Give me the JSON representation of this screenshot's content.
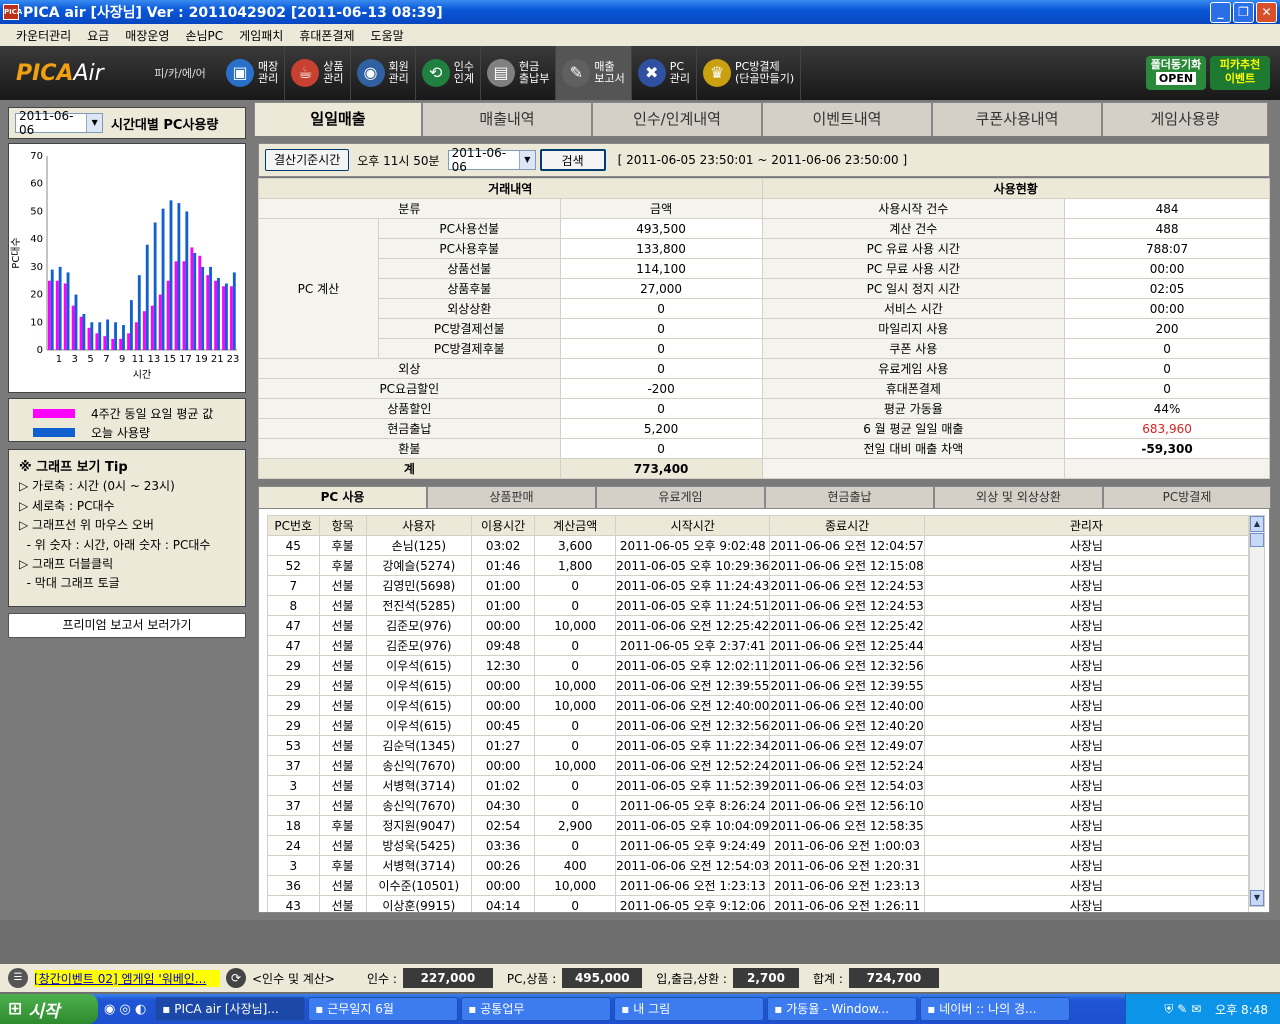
{
  "window": {
    "title": "PICA air [사장님]   Ver : 2011042902 [2011-06-13 08:39]"
  },
  "menu": [
    "카운터관리",
    "요금",
    "매장운영",
    "손님PC",
    "게임패치",
    "휴대폰결제",
    "도움말"
  ],
  "toolbar": {
    "logo_main": "PICA",
    "logo_sub": "Air",
    "region": "피/카/에/어",
    "items": [
      {
        "label1": "매장",
        "label2": "관리",
        "icon": "monitor-icon",
        "color": "#2a70c8",
        "glyph": "▣"
      },
      {
        "label1": "상품",
        "label2": "관리",
        "icon": "cup-icon",
        "color": "#c84030",
        "glyph": "☕"
      },
      {
        "label1": "회원",
        "label2": "관리",
        "icon": "globe-icon",
        "color": "#3060a0",
        "glyph": "◉"
      },
      {
        "label1": "인수",
        "label2": "인계",
        "icon": "handover-icon",
        "color": "#208040",
        "glyph": "⟲"
      },
      {
        "label1": "현금",
        "label2": "출납부",
        "icon": "cash-icon",
        "color": "#808080",
        "glyph": "▤"
      },
      {
        "label1": "매출",
        "label2": "보고서",
        "icon": "report-icon",
        "color": "#606060",
        "glyph": "✎"
      },
      {
        "label1": "PC",
        "label2": "관리",
        "icon": "tools-icon",
        "color": "#3050a0",
        "glyph": "✖"
      },
      {
        "label1": "PC방결제",
        "label2": "(단골만들기)",
        "icon": "crown-icon",
        "color": "#c8a010",
        "glyph": "♛"
      }
    ],
    "promo1_a": "폴더동기화",
    "promo1_b": "OPEN",
    "promo2_a": "피카추천",
    "promo2_b": "이벤트"
  },
  "leftpanel": {
    "date": "2011-06-06",
    "title": "시간대별 PC사용량",
    "legend_avg": "4주간 동일 요일 평균 값",
    "legend_today": "오늘 사용량",
    "tip_title": "※ 그래프 보기 Tip",
    "tips": [
      "▷ 가로축 : 시간 (0시 ~ 23시)",
      "▷ 세로축 : PC대수",
      "▷ 그래프선 위 마우스 오버",
      "  - 위 숫자 : 시간, 아래 숫자 : PC대수",
      "▷ 그래프 더블클릭",
      "  - 막대 그래프 토글"
    ],
    "premium": "프리미엄 보고서 보러가기"
  },
  "chart_data": {
    "type": "bar",
    "xlabel": "시간",
    "ylabel": "PC대수",
    "ylim": [
      0,
      70
    ],
    "yticks": [
      0,
      10,
      20,
      30,
      40,
      50,
      60,
      70
    ],
    "xticks": [
      "1",
      "3",
      "5",
      "7",
      "9",
      "11",
      "13",
      "15",
      "17",
      "19",
      "21",
      "23"
    ],
    "categories": [
      0,
      1,
      2,
      3,
      4,
      5,
      6,
      7,
      8,
      9,
      10,
      11,
      12,
      13,
      14,
      15,
      16,
      17,
      18,
      19,
      20,
      21,
      22,
      23
    ],
    "series": [
      {
        "name": "4주간 동일 요일 평균 값",
        "color": "#ff00ff",
        "values": [
          25,
          25,
          24,
          16,
          12,
          8,
          6,
          5,
          4,
          4,
          6,
          10,
          14,
          16,
          20,
          25,
          32,
          32,
          37,
          34,
          27,
          25,
          23,
          23
        ]
      },
      {
        "name": "오늘 사용량",
        "color": "#1060d0",
        "values": [
          29,
          30,
          28,
          20,
          13,
          10,
          10,
          11,
          10,
          9,
          18,
          27,
          38,
          46,
          51,
          54,
          53,
          50,
          35,
          30,
          30,
          26,
          24,
          28
        ]
      }
    ]
  },
  "tabs": [
    "일일매출",
    "매출내역",
    "인수/인계내역",
    "이벤트내역",
    "쿠폰사용내역",
    "게임사용량"
  ],
  "search": {
    "button1": "결산기준시간",
    "time": "오후 11시 50분",
    "date": "2011-06-06",
    "button2": "검색",
    "range": "[ 2011-06-05 23:50:01 ~ 2011-06-06 23:50:00 ]"
  },
  "summary": {
    "h_left": "거래내역",
    "h_right": "사용현황",
    "col_cat": "분류",
    "col_amt": "금액",
    "group": "PC 계산",
    "rows_left": [
      {
        "label": "PC사용선불",
        "value": "493,500"
      },
      {
        "label": "PC사용후불",
        "value": "133,800"
      },
      {
        "label": "상품선불",
        "value": "114,100"
      },
      {
        "label": "상품후불",
        "value": "27,000"
      },
      {
        "label": "외상상환",
        "value": "0"
      },
      {
        "label": "PC방결제선불",
        "value": "0"
      },
      {
        "label": "PC방결제후불",
        "value": "0"
      }
    ],
    "rows_left2": [
      {
        "label": "외상",
        "value": "0"
      },
      {
        "label": "PC요금할인",
        "value": "-200"
      },
      {
        "label": "상품할인",
        "value": "0"
      },
      {
        "label": "현금출납",
        "value": "5,200"
      },
      {
        "label": "환불",
        "value": "0"
      }
    ],
    "total_label": "계",
    "total_value": "773,400",
    "rows_right": [
      {
        "label": "사용시작 건수",
        "value": "484"
      },
      {
        "label": "계산 건수",
        "value": "488"
      },
      {
        "label": "PC 유료 사용 시간",
        "value": "788:07"
      },
      {
        "label": "PC 무료 사용 시간",
        "value": "00:00"
      },
      {
        "label": "PC 일시 정지 시간",
        "value": "02:05"
      },
      {
        "label": "서비스 시간",
        "value": "00:00"
      },
      {
        "label": "마일리지 사용",
        "value": "200"
      },
      {
        "label": "쿠폰 사용",
        "value": "0"
      },
      {
        "label": "유료게임 사용",
        "value": "0"
      },
      {
        "label": "휴대폰결제",
        "value": "0"
      },
      {
        "label": "평균 가동율",
        "value": "44%"
      },
      {
        "label": "6 월 평균 일일 매출",
        "value": "683,960"
      },
      {
        "label": "전일 대비 매출 차액",
        "value": "-59,300"
      }
    ],
    "colors": {
      "red": "#e02020"
    }
  },
  "subtabs": [
    "PC 사용",
    "상품판매",
    "유료게임",
    "현금출납",
    "외상 및 외상상환",
    "PC방결제"
  ],
  "usage": {
    "columns": [
      "PC번호",
      "항목",
      "사용자",
      "이용시간",
      "계산금액",
      "시작시간",
      "종료시간",
      "관리자"
    ],
    "rows": [
      [
        "45",
        "후불",
        "손님(125)",
        "03:02",
        "3,600",
        "2011-06-05 오후 9:02:48",
        "2011-06-06 오전 12:04:57",
        "사장님"
      ],
      [
        "52",
        "후불",
        "강예슬(5274)",
        "01:46",
        "1,800",
        "2011-06-05 오후 10:29:36",
        "2011-06-06 오전 12:15:08",
        "사장님"
      ],
      [
        "7",
        "선불",
        "김영민(5698)",
        "01:00",
        "0",
        "2011-06-05 오후 11:24:43",
        "2011-06-06 오전 12:24:53",
        "사장님"
      ],
      [
        "8",
        "선불",
        "전진석(5285)",
        "01:00",
        "0",
        "2011-06-05 오후 11:24:51",
        "2011-06-06 오전 12:24:53",
        "사장님"
      ],
      [
        "47",
        "선불",
        "김준모(976)",
        "00:00",
        "10,000",
        "2011-06-06 오전 12:25:42",
        "2011-06-06 오전 12:25:42",
        "사장님"
      ],
      [
        "47",
        "선불",
        "김준모(976)",
        "09:48",
        "0",
        "2011-06-05 오후 2:37:41",
        "2011-06-06 오전 12:25:44",
        "사장님"
      ],
      [
        "29",
        "선불",
        "이우석(615)",
        "12:30",
        "0",
        "2011-06-05 오후 12:02:11",
        "2011-06-06 오전 12:32:56",
        "사장님"
      ],
      [
        "29",
        "선불",
        "이우석(615)",
        "00:00",
        "10,000",
        "2011-06-06 오전 12:39:55",
        "2011-06-06 오전 12:39:55",
        "사장님"
      ],
      [
        "29",
        "선불",
        "이우석(615)",
        "00:00",
        "10,000",
        "2011-06-06 오전 12:40:00",
        "2011-06-06 오전 12:40:00",
        "사장님"
      ],
      [
        "29",
        "선불",
        "이우석(615)",
        "00:45",
        "0",
        "2011-06-06 오전 12:32:56",
        "2011-06-06 오전 12:40:20",
        "사장님"
      ],
      [
        "53",
        "선불",
        "김순덕(1345)",
        "01:27",
        "0",
        "2011-06-05 오후 11:22:34",
        "2011-06-06 오전 12:49:07",
        "사장님"
      ],
      [
        "37",
        "선불",
        "송신익(7670)",
        "00:00",
        "10,000",
        "2011-06-06 오전 12:52:24",
        "2011-06-06 오전 12:52:24",
        "사장님"
      ],
      [
        "3",
        "선불",
        "서병혁(3714)",
        "01:02",
        "0",
        "2011-06-05 오후 11:52:39",
        "2011-06-06 오전 12:54:03",
        "사장님"
      ],
      [
        "37",
        "선불",
        "송신익(7670)",
        "04:30",
        "0",
        "2011-06-05 오후 8:26:24",
        "2011-06-06 오전 12:56:10",
        "사장님"
      ],
      [
        "18",
        "후불",
        "정지원(9047)",
        "02:54",
        "2,900",
        "2011-06-05 오후 10:04:09",
        "2011-06-06 오전 12:58:35",
        "사장님"
      ],
      [
        "24",
        "선불",
        "방성욱(5425)",
        "03:36",
        "0",
        "2011-06-05 오후 9:24:49",
        "2011-06-06 오전 1:00:03",
        "사장님"
      ],
      [
        "3",
        "후불",
        "서병혁(3714)",
        "00:26",
        "400",
        "2011-06-06 오전 12:54:03",
        "2011-06-06 오전 1:20:31",
        "사장님"
      ],
      [
        "36",
        "선불",
        "이수준(10501)",
        "00:00",
        "10,000",
        "2011-06-06 오전 1:23:13",
        "2011-06-06 오전 1:23:13",
        "사장님"
      ],
      [
        "43",
        "선불",
        "이상훈(9915)",
        "04:14",
        "0",
        "2011-06-05 오후 9:12:06",
        "2011-06-06 오전 1:26:11",
        "사장님"
      ]
    ]
  },
  "bottom": {
    "event": "[창간이벤트 02] 엠게임 '워베인...",
    "handover": "<인수 및 계산>",
    "l1": "인수 :",
    "v1": "227,000",
    "l2": "PC,상품 :",
    "v2": "495,000",
    "l3": "입,출금,상환 :",
    "v3": "2,700",
    "l4": "합계 :",
    "v4": "724,700"
  },
  "taskbar": {
    "start": "시작",
    "tasks": [
      "PICA air [사장님]...",
      "근무일지 6월",
      "공통업무",
      "내 그림",
      "가동율 - Window...",
      "네이버 :: 나의 경..."
    ],
    "clock": "오후 8:48"
  }
}
